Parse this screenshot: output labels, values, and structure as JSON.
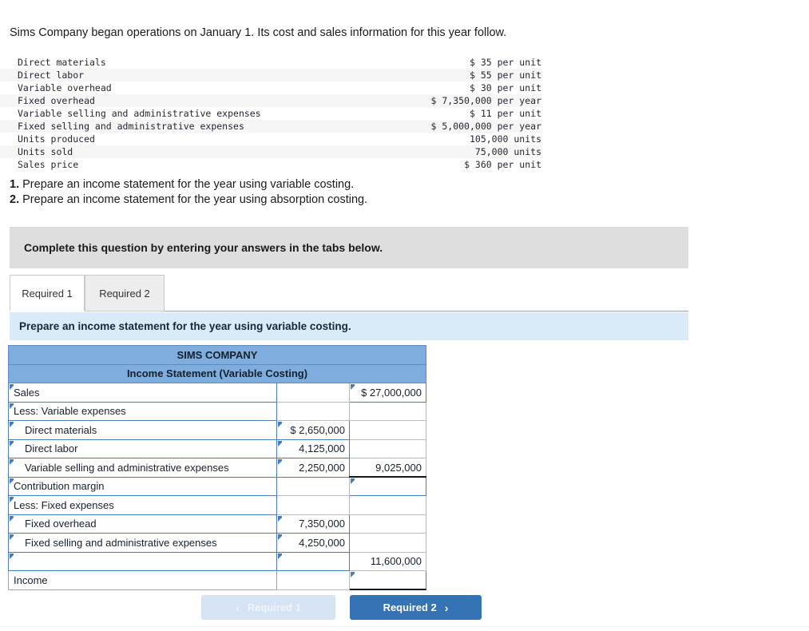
{
  "intro": "Sims Company began operations on January 1. Its cost and sales information for this year follow.",
  "facts": [
    {
      "label": "Direct materials",
      "value": "$ 35 per unit"
    },
    {
      "label": "Direct labor",
      "value": "$ 55 per unit"
    },
    {
      "label": "Variable overhead",
      "value": "$ 30 per unit"
    },
    {
      "label": "Fixed overhead",
      "value": "$ 7,350,000 per year"
    },
    {
      "label": "Variable selling and administrative expenses",
      "value": "$ 11 per unit"
    },
    {
      "label": "Fixed selling and administrative expenses",
      "value": "$ 5,000,000 per year"
    },
    {
      "label": "Units produced",
      "value": "105,000 units"
    },
    {
      "label": "Units sold",
      "value": "75,000 units"
    },
    {
      "label": "Sales price",
      "value": "$ 360 per unit"
    }
  ],
  "requirements": [
    {
      "num": "1.",
      "text": "Prepare an income statement for the year using variable costing."
    },
    {
      "num": "2.",
      "text": "Prepare an income statement for the year using absorption costing."
    }
  ],
  "banner": {
    "text": "Complete this question by entering your answers in the tabs below."
  },
  "tabs": [
    {
      "label": "Required 1",
      "active": true
    },
    {
      "label": "Required 2",
      "active": false
    }
  ],
  "prompt": {
    "text": "Prepare an income statement for the year using variable costing."
  },
  "statement": {
    "title": "SIMS COMPANY",
    "subtitle": "Income Statement (Variable Costing)",
    "rows": [
      {
        "label": "Sales",
        "indent": false,
        "label_style": "blue",
        "c2": "",
        "c2_style": "plain",
        "c3": "$  27,000,000",
        "c3_style": "blue"
      },
      {
        "label": "Less: Variable expenses",
        "indent": false,
        "label_style": "blue",
        "c2": "",
        "c2_style": "plain",
        "c3": "",
        "c3_style": "plain"
      },
      {
        "label": "Direct materials",
        "indent": true,
        "label_style": "blue",
        "c2": "$  2,650,000",
        "c2_style": "blue",
        "c3": "",
        "c3_style": "plain"
      },
      {
        "label": "Direct labor",
        "indent": true,
        "label_style": "blue",
        "c2": "4,125,000",
        "c2_style": "blue",
        "c3": "",
        "c3_style": "plain"
      },
      {
        "label": "Variable selling and administrative expenses",
        "indent": true,
        "label_style": "blue",
        "c2": "2,250,000",
        "c2_style": "blue",
        "c3": "9,025,000",
        "c3_style": "plain"
      },
      {
        "label": "Contribution margin",
        "indent": false,
        "label_style": "blue",
        "c2": "",
        "c2_style": "plain",
        "c3": "",
        "c3_style": "blue-topline"
      },
      {
        "label": "Less: Fixed expenses",
        "indent": false,
        "label_style": "blue",
        "c2": "",
        "c2_style": "plain",
        "c3": "",
        "c3_style": "plain"
      },
      {
        "label": "Fixed overhead",
        "indent": true,
        "label_style": "blue",
        "c2": "7,350,000",
        "c2_style": "blue",
        "c3": "",
        "c3_style": "plain"
      },
      {
        "label": "Fixed selling and administrative expenses",
        "indent": true,
        "label_style": "blue",
        "c2": "4,250,000",
        "c2_style": "blue",
        "c3": "",
        "c3_style": "plain"
      },
      {
        "label": "",
        "indent": false,
        "label_style": "blue",
        "c2": "",
        "c2_style": "blue",
        "c3": "11,600,000",
        "c3_style": "plain"
      },
      {
        "label": "Income",
        "indent": false,
        "label_style": "gray",
        "c2": "",
        "c2_style": "plain",
        "c3": "",
        "c3_style": "blue-dbl"
      }
    ]
  },
  "nav": {
    "prev_label": "Required 1",
    "prev_chevron": "‹",
    "next_label": "Required 2",
    "next_chevron": "›"
  },
  "colors": {
    "header_blue": "#7fadde",
    "prompt_blue": "#d9ebf9",
    "banner_gray": "#dedede",
    "active_border": "#4a7cb5",
    "next_button": "#3673b5",
    "prev_button": "#d6e3f2"
  }
}
